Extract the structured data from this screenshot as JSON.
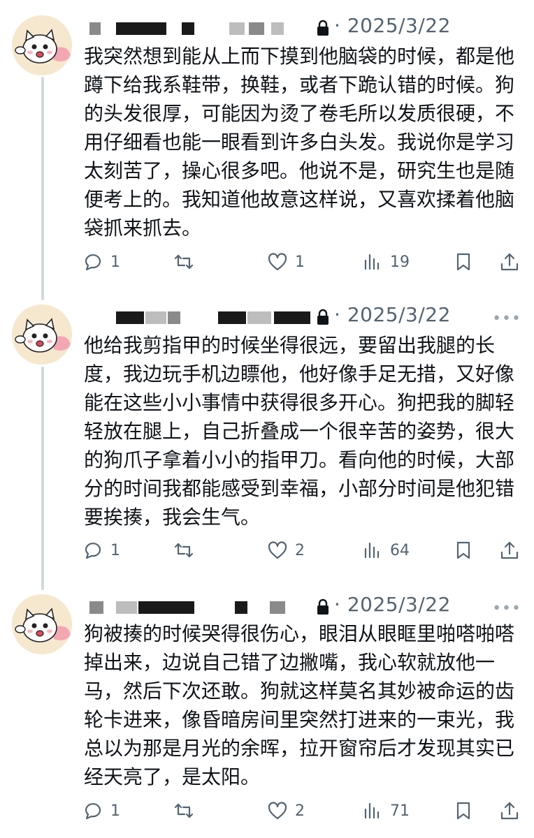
{
  "tweets": [
    {
      "date": "2025/3/22",
      "text": "我突然想到能从上而下摸到他脑袋的时候，都是他蹲下给我系鞋带，换鞋，或者下跪认错的时候。狗的头发很厚，可能因为烫了卷毛所以发质很硬，不用仔细看也能一眼看到许多白头发。我说你是学习太刻苦了，操心很多吧。他说不是，研究生也是随便考上的。我知道他故意这样说，又喜欢揉着他脑袋抓来抓去。",
      "replies": "1",
      "retweets": "",
      "likes": "1",
      "views": "19"
    },
    {
      "date": "2025/3/22",
      "text": "他给我剪指甲的时候坐得很远，要留出我腿的长度，我边玩手机边瞟他，他好像手足无措，又好像能在这些小小事情中获得很多开心。狗把我的脚轻轻放在腿上，自己折叠成一个很辛苦的姿势，很大的狗爪子拿着小小的指甲刀。看向他的时候，大部分的时间我都能感受到幸福，小部分时间是他犯错要挨揍，我会生气。",
      "replies": "1",
      "retweets": "",
      "likes": "2",
      "views": "64"
    },
    {
      "date": "2025/3/22",
      "text": "狗被揍的时候哭得很伤心，眼泪从眼眶里啪嗒啪嗒掉出来，边说自己错了边撇嘴，我心软就放他一马，然后下次还敢。狗就这样莫名其妙被命运的齿轮卡进来，像昏暗房间里突然打进来的一束光，我总以为那是月光的余晖，拉开窗帘后才发现其实已经天亮了，是太阳。",
      "replies": "1",
      "retweets": "",
      "likes": "2",
      "views": "71"
    }
  ],
  "icons": [
    "reply-icon",
    "retweet-icon",
    "like-icon",
    "views-icon",
    "bookmark-icon",
    "share-icon",
    "lock-icon",
    "more-icon"
  ],
  "more_label": "•••",
  "colors": {
    "text": "#0f1419",
    "muted": "#536471",
    "thread_line": "#cfd9de"
  }
}
